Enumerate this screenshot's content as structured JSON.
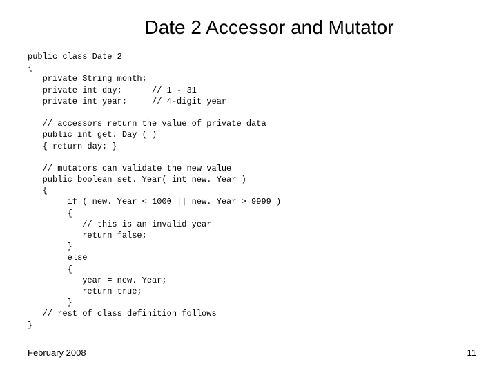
{
  "slide": {
    "title": "Date 2 Accessor and Mutator",
    "code": "public class Date 2\n{\n   private String month;\n   private int day;      // 1 - 31\n   private int year;     // 4-digit year\n\n   // accessors return the value of private data\n   public int get. Day ( )\n   { return day; }\n\n   // mutators can validate the new value\n   public boolean set. Year( int new. Year )\n   {\n        if ( new. Year < 1000 || new. Year > 9999 )\n        {\n           // this is an invalid year\n           return false;\n        }\n        else\n        {\n           year = new. Year;\n           return true;\n        }\n   // rest of class definition follows\n}",
    "footer_date": "February 2008",
    "footer_page": "11"
  }
}
